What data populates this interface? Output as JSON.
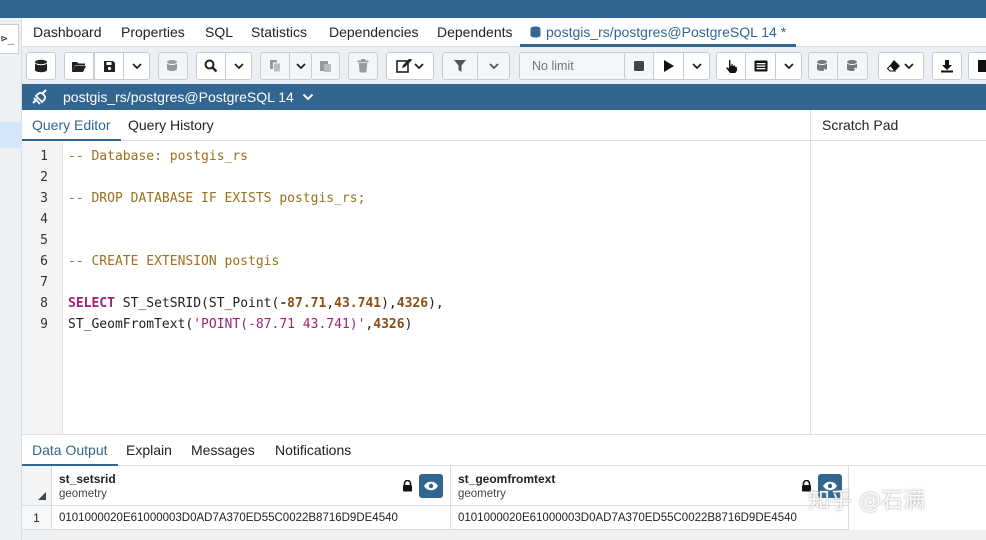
{
  "tabs": [
    {
      "label": "Dashboard"
    },
    {
      "label": "Properties"
    },
    {
      "label": "SQL"
    },
    {
      "label": "Statistics"
    },
    {
      "label": "Dependencies"
    },
    {
      "label": "Dependents"
    },
    {
      "label": "postgis_rs/postgres@PostgreSQL 14 *"
    }
  ],
  "left_strip": {
    "terminal_glyph": "⊳_"
  },
  "toolbar": {
    "limit_select": "No limit",
    "icons": [
      "database-connect",
      "open-file",
      "save",
      "sql-macro",
      "search",
      "copy",
      "paste",
      "delete",
      "edit",
      "filter",
      "stop",
      "execute",
      "explain",
      "explain-analyze",
      "commit",
      "rollback",
      "clear",
      "download",
      "macro"
    ]
  },
  "connection": {
    "label": "postgis_rs/postgres@PostgreSQL 14"
  },
  "query_tabs": [
    {
      "label": "Query Editor"
    },
    {
      "label": "Query History"
    }
  ],
  "scratch_pad": {
    "title": "Scratch Pad"
  },
  "editor": {
    "line_numbers": [
      "1",
      "2",
      "3",
      "4",
      "5",
      "6",
      "7",
      "8",
      "9"
    ],
    "lines": {
      "l1": "-- Database: postgis_rs",
      "l3": "-- DROP DATABASE IF EXISTS postgis_rs;",
      "l6": "-- CREATE EXTENSION postgis",
      "l8_kw": "SELECT",
      "l8_a": " ST_SetSRID(ST_Point(",
      "l8_n1": "-87.71",
      "l8_c1": ",",
      "l8_n2": "43.741",
      "l8_c2": "),",
      "l8_n3": "4326",
      "l8_c3": "),",
      "l9_a": "ST_GeomFromText(",
      "l9_s": "'POINT(-87.71 43.741)'",
      "l9_c": ",",
      "l9_n": "4326",
      "l9_e": ")"
    }
  },
  "output_tabs": [
    {
      "label": "Data Output"
    },
    {
      "label": "Explain"
    },
    {
      "label": "Messages"
    },
    {
      "label": "Notifications"
    }
  ],
  "result": {
    "columns": [
      {
        "name": "st_setsrid",
        "type": "geometry"
      },
      {
        "name": "st_geomfromtext",
        "type": "geometry"
      }
    ],
    "rows": [
      {
        "num": "1",
        "cells": [
          "0101000020E61000003D0AD7A370ED55C0022B8716D9DE4540",
          "0101000020E61000003D0AD7A370ED55C0022B8716D9DE4540"
        ]
      }
    ]
  },
  "watermark": "知乎 @石满",
  "colors": {
    "brand": "#326690",
    "comment": "#9a6f1e",
    "keyword": "#a1217a"
  }
}
